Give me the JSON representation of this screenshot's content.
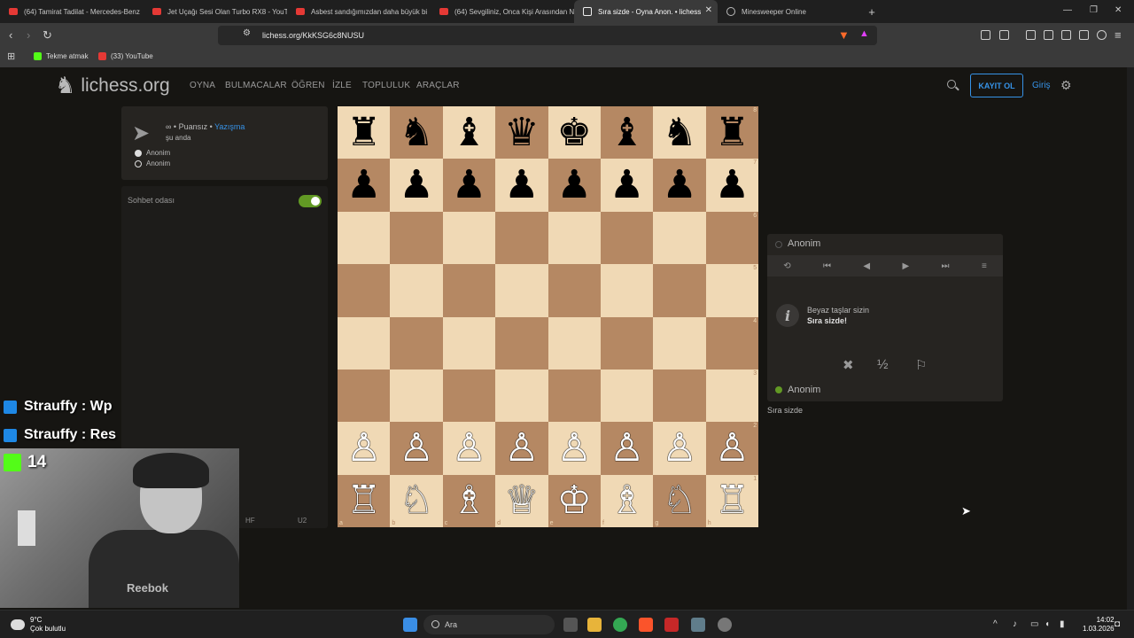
{
  "browser": {
    "tabs": [
      {
        "title": "(64) Tamirat Tadilat - Mercedes-Benz",
        "icon": "youtube-icon",
        "active": false
      },
      {
        "title": "Jet Uçağı Sesi Olan Turbo RX8 - YouT",
        "icon": "youtube-icon",
        "active": false
      },
      {
        "title": "Asbest sandığımızdan daha büyük bi",
        "icon": "youtube-icon",
        "active": false
      },
      {
        "title": "(64) Sevgiliniz, Onca Kişi Arasından N",
        "icon": "youtube-icon",
        "active": false
      },
      {
        "title": "Sıra sizde - Oyna Anon. • lichess",
        "icon": "lichess-icon",
        "active": true
      },
      {
        "title": "Minesweeper Online",
        "icon": "globe-icon",
        "active": false
      }
    ],
    "url": "lichess.org/KkKSG6c8NUSU",
    "bookmarks": [
      {
        "label": "Tekme atmak",
        "icon": "kick-icon",
        "color": "#53fc18"
      },
      {
        "label": "(33) YouTube",
        "icon": "youtube-icon",
        "color": "#e53935"
      }
    ]
  },
  "site": {
    "logo": "lichess.org",
    "nav": [
      "OYNA",
      "BULMACALAR",
      "ÖĞREN",
      "İZLE",
      "TOPLULUK",
      "ARAÇLAR"
    ],
    "signup": "KAYIT OL",
    "login": "Giriş"
  },
  "game": {
    "meta_prefix": "∞ • Puansız •",
    "meta_link": "Yazışma",
    "time": "şu anda",
    "players": [
      "Anonim",
      "Anonim"
    ],
    "chat_label": "Sohbet odası",
    "chat_tabs": [
      "HF",
      "U2"
    ],
    "ranks": [
      "8",
      "7",
      "6",
      "5",
      "4",
      "3",
      "2",
      "1"
    ],
    "files": [
      "a",
      "b",
      "c",
      "d",
      "e",
      "f",
      "g",
      "h"
    ],
    "board": [
      [
        "♜",
        "♞",
        "♝",
        "♛",
        "♚",
        "♝",
        "♞",
        "♜"
      ],
      [
        "♟",
        "♟",
        "♟",
        "♟",
        "♟",
        "♟",
        "♟",
        "♟"
      ],
      [
        "",
        "",
        "",
        "",
        "",
        "",
        "",
        ""
      ],
      [
        "",
        "",
        "",
        "",
        "",
        "",
        "",
        ""
      ],
      [
        "",
        "",
        "",
        "",
        "",
        "",
        "",
        ""
      ],
      [
        "",
        "",
        "",
        "",
        "",
        "",
        "",
        ""
      ],
      [
        "♙",
        "♙",
        "♙",
        "♙",
        "♙",
        "♙",
        "♙",
        "♙"
      ],
      [
        "♖",
        "♘",
        "♗",
        "♕",
        "♔",
        "♗",
        "♘",
        "♖"
      ]
    ],
    "opponent": "Anonim",
    "message_line1": "Beyaz taşlar sizin",
    "message_line2": "Sıra sizde!",
    "half_label": "½",
    "me": "Anonim",
    "turn_label": "Sıra sizde"
  },
  "overlay": {
    "chat_lines": [
      "Strauffy : Wp",
      "Strauffy : Res"
    ],
    "kick_count": "14",
    "shirt_logo": "Reebok"
  },
  "taskbar": {
    "temp": "9°C",
    "weather": "Çok bulutlu",
    "search_placeholder": "Ara",
    "time": "14:02",
    "date": "1.03.2026"
  }
}
